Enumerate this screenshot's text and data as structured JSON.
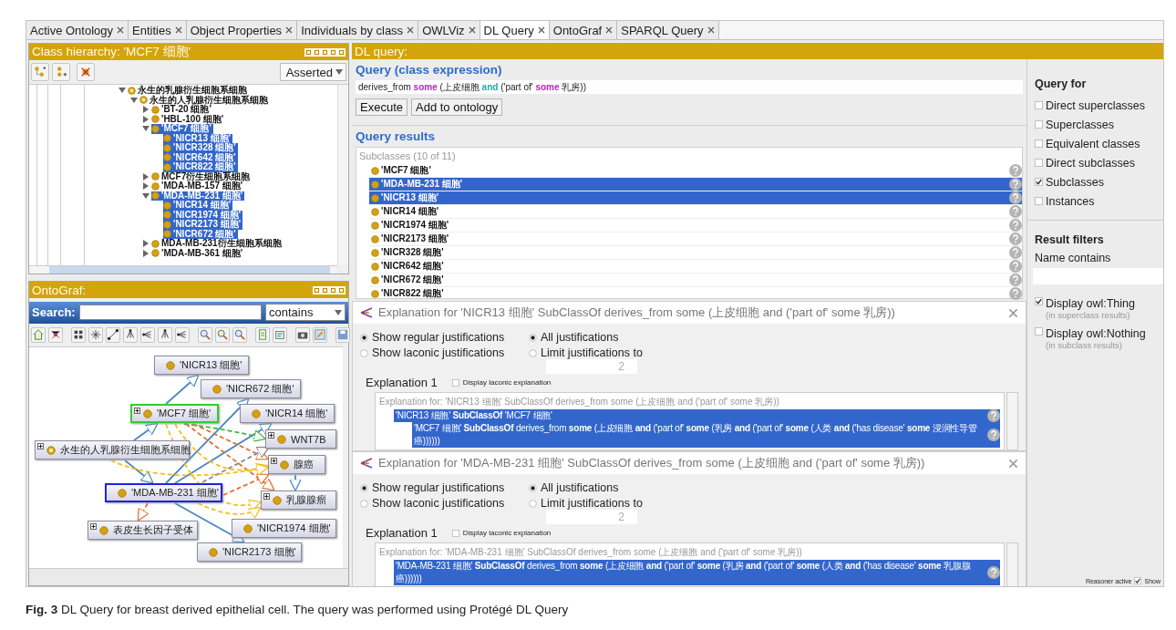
{
  "tabs": [
    {
      "label": "Active Ontology",
      "selected": false
    },
    {
      "label": "Entities",
      "selected": false
    },
    {
      "label": "Object Properties",
      "selected": false
    },
    {
      "label": "Individuals by class",
      "selected": false
    },
    {
      "label": "OWLViz",
      "selected": false
    },
    {
      "label": "DL Query",
      "selected": true
    },
    {
      "label": "OntoGraf",
      "selected": false
    },
    {
      "label": "SPARQL Query",
      "selected": false
    }
  ],
  "class_hierarchy": {
    "title": "Class hierarchy: 'MCF7 细胞'",
    "mode": "Asserted",
    "tree": [
      {
        "label": "永生的乳腺衍生细胞系细胞",
        "kind": "defined",
        "expanded": true,
        "selected": false,
        "children": [
          {
            "label": "永生的人乳腺衍生细胞系细胞",
            "kind": "defined",
            "expanded": true,
            "selected": false,
            "children": [
              {
                "label": "'BT-20 细胞'",
                "kind": "class",
                "expanded": false,
                "selected": false
              },
              {
                "label": "'HBL-100 细胞'",
                "kind": "class",
                "expanded": false,
                "selected": false
              },
              {
                "label": "'MCF7 细胞'",
                "kind": "class",
                "expanded": true,
                "selected": true,
                "children": [
                  {
                    "label": "'NICR13 细胞'",
                    "kind": "class",
                    "selected": true
                  },
                  {
                    "label": "'NICR328 细胞'",
                    "kind": "class",
                    "selected": true
                  },
                  {
                    "label": "'NICR642 细胞'",
                    "kind": "class",
                    "selected": true
                  },
                  {
                    "label": "'NICR822 细胞'",
                    "kind": "class",
                    "selected": true
                  }
                ]
              },
              {
                "label": "MCF7衍生细胞系细胞",
                "kind": "class",
                "expanded": false,
                "selected": false
              },
              {
                "label": "'MDA-MB-157 细胞'",
                "kind": "class",
                "expanded": false,
                "selected": false
              },
              {
                "label": "'MDA-MB-231 细胞'",
                "kind": "class",
                "expanded": true,
                "selected": true,
                "children": [
                  {
                    "label": "'NICR14 细胞'",
                    "kind": "class",
                    "selected": true
                  },
                  {
                    "label": "'NICR1974 细胞'",
                    "kind": "class",
                    "selected": true
                  },
                  {
                    "label": "'NICR2173 细胞'",
                    "kind": "class",
                    "selected": true
                  },
                  {
                    "label": "'NICR672 细胞'",
                    "kind": "class",
                    "selected": true
                  }
                ]
              },
              {
                "label": "MDA-MB-231衍生细胞系细胞",
                "kind": "class",
                "expanded": false,
                "selected": false
              },
              {
                "label": "'MDA-MB-361 细胞'",
                "kind": "class",
                "expanded": false,
                "selected": false
              }
            ]
          }
        ]
      }
    ]
  },
  "ontograf": {
    "title": "OntoGraf:",
    "search_label": "Search:",
    "match": "contains",
    "nodes": [
      {
        "label": "'NICR13 细胞'",
        "kind": "class",
        "expandable": false,
        "color": "#8c8ca0"
      },
      {
        "label": "'NICR672 细胞'",
        "kind": "class",
        "expandable": false,
        "color": "#8c8ca0"
      },
      {
        "label": "'MCF7 细胞'",
        "kind": "class",
        "expandable": true,
        "color": "#33cc33"
      },
      {
        "label": "'NICR14 细胞'",
        "kind": "class",
        "expandable": false,
        "color": "#8c8ca0"
      },
      {
        "label": "WNT7B",
        "kind": "class",
        "expandable": true,
        "color": "#8c8ca0"
      },
      {
        "label": "永生的人乳腺衍生细胞系细胞",
        "kind": "defined",
        "expandable": true,
        "color": "#8c8ca0"
      },
      {
        "label": "腺癌",
        "kind": "class",
        "expandable": true,
        "color": "#8c8ca0"
      },
      {
        "label": "'MDA-MB-231 细胞'",
        "kind": "class",
        "expandable": false,
        "color": "#2222dd"
      },
      {
        "label": "乳腺腺瘤",
        "kind": "class",
        "expandable": true,
        "color": "#8c8ca0"
      },
      {
        "label": "表皮生长因子受体",
        "kind": "class",
        "expandable": true,
        "color": "#8c8ca0"
      },
      {
        "label": "'NICR1974 细胞'",
        "kind": "class",
        "expandable": false,
        "color": "#8c8ca0"
      },
      {
        "label": "'NICR2173 细胞'",
        "kind": "class",
        "expandable": false,
        "color": "#8c8ca0"
      }
    ]
  },
  "dl_query": {
    "title": "DL query:",
    "query_heading": "Query (class expression)",
    "expression": [
      {
        "text": "derives_from ",
        "kind": "plain"
      },
      {
        "text": "some",
        "kind": "quantifier"
      },
      {
        "text": " (上皮细胞 ",
        "kind": "plain"
      },
      {
        "text": "and",
        "kind": "connective"
      },
      {
        "text": " ('part of' ",
        "kind": "plain"
      },
      {
        "text": "some",
        "kind": "quantifier"
      },
      {
        "text": " 乳房))",
        "kind": "plain"
      }
    ],
    "buttons": [
      "Execute",
      "Add to ontology"
    ],
    "results_heading": "Query results",
    "results_group": "Subclasses (10 of 11)",
    "results": [
      {
        "label": "'MCF7 细胞'",
        "selected": false
      },
      {
        "label": "'MDA-MB-231 细胞'",
        "selected": true
      },
      {
        "label": "'NICR13 细胞'",
        "selected": true
      },
      {
        "label": "'NICR14 细胞'",
        "selected": false
      },
      {
        "label": "'NICR1974 细胞'",
        "selected": false
      },
      {
        "label": "'NICR2173 细胞'",
        "selected": false
      },
      {
        "label": "'NICR328 细胞'",
        "selected": false
      },
      {
        "label": "'NICR642 细胞'",
        "selected": false
      },
      {
        "label": "'NICR672 细胞'",
        "selected": false
      },
      {
        "label": "'NICR822 细胞'",
        "selected": false
      }
    ]
  },
  "explanations": [
    {
      "title": "Explanation for 'NICR13 细胞' SubClassOf derives_from some  (上皮细胞 and ('part of' some 乳房))",
      "justification_modes": [
        {
          "label": "Show regular justifications",
          "selected": true
        },
        {
          "label": "Show laconic justifications",
          "selected": false
        }
      ],
      "limit_modes": [
        {
          "label": "All justifications",
          "selected": true
        },
        {
          "label": "Limit justifications to",
          "selected": false
        }
      ],
      "limit": "2",
      "explanation_label": "Explanation 1",
      "laconic": {
        "label": "Display laconic explanation",
        "checked": false
      },
      "header": "Explanation for: 'NICR13 细胞' SubClassOf derives_from some (上皮细胞 and ('part of' some 乳房))",
      "axioms": [
        {
          "text": "'NICR13 细胞' **SubClassOf** 'MCF7 细胞'",
          "selected": true,
          "children": [
            {
              "text": "'MCF7 细胞' **SubClassOf** derives_from **some** (上皮细胞 **and** ('part of' **some** (乳房 **and** ('part of' **some** (人类 **and** ('has disease' **some** 浸润性导管癌))))))",
              "selected": true
            }
          ]
        }
      ]
    },
    {
      "title": "Explanation for 'MDA-MB-231 细胞' SubClassOf derives_from some  (上皮细胞 and ('part of' some 乳房))",
      "justification_modes": [
        {
          "label": "Show regular justifications",
          "selected": true
        },
        {
          "label": "Show laconic justifications",
          "selected": false
        }
      ],
      "limit_modes": [
        {
          "label": "All justifications",
          "selected": true
        },
        {
          "label": "Limit justifications to",
          "selected": false
        }
      ],
      "limit": "2",
      "explanation_label": "Explanation 1",
      "laconic": {
        "label": "Display laconic explanation",
        "checked": false
      },
      "header": "Explanation for: 'MDA-MB-231 细胞' SubClassOf derives_from some (上皮细胞 and ('part of' some 乳房))",
      "axioms": [
        {
          "text": "'MDA-MB-231 细胞' **SubClassOf** derives_from **some** (上皮细胞 **and** ('part of' **some** (乳房 **and** ('part of' **some** (人类 **and** ('has disease' **some** 乳腺腺癌))))))",
          "selected": true
        }
      ]
    }
  ],
  "query_for": {
    "title": "Query for",
    "options": [
      {
        "label": "Direct superclasses",
        "checked": false
      },
      {
        "label": "Superclasses",
        "checked": false
      },
      {
        "label": "Equivalent classes",
        "checked": false
      },
      {
        "label": "Direct subclasses",
        "checked": false
      },
      {
        "label": "Subclasses",
        "checked": true
      },
      {
        "label": "Instances",
        "checked": false
      }
    ]
  },
  "result_filters": {
    "title": "Result filters",
    "name_label": "Name contains",
    "options": [
      {
        "label": "Display owl:Thing",
        "note": "(in superclass results)",
        "checked": true
      },
      {
        "label": "Display owl:Nothing",
        "note": "(in subclass results)",
        "checked": false
      }
    ]
  },
  "status": {
    "label": "Reasoner active",
    "show": {
      "label": "Show",
      "checked": true
    }
  },
  "caption": "**Fig. 3** DL Query for breast derived epithelial cell. The query was performed using Protégé DL Query"
}
